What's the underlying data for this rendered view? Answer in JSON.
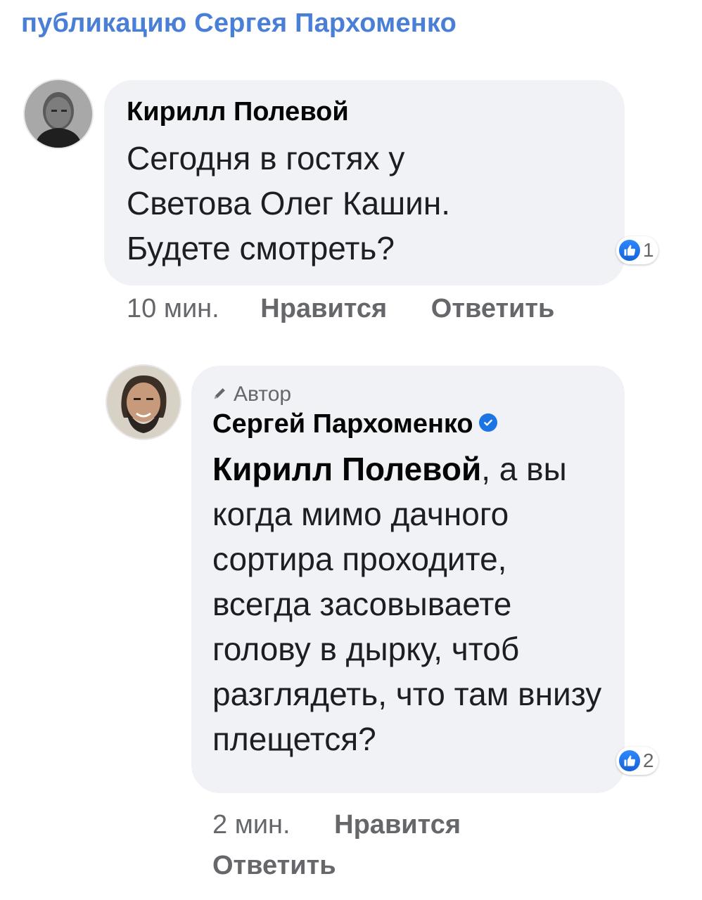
{
  "header": {
    "link_text": "публикацию Сергея Пархоменко"
  },
  "comment1": {
    "author": "Кирилл Полевой",
    "text": "Сегодня в гостях у Светова Олег Кашин. Будете смотреть?",
    "reaction_count": "1",
    "time": "10 мин.",
    "like_label": "Нравится",
    "reply_label": "Ответить"
  },
  "comment2": {
    "author_tag": "Автор",
    "author": "Сергей Пархоменко",
    "mention": "Кирилл Полевой",
    "text": ", а вы когда мимо дачного сортира проходите, всегда засовываете голову в дырку, чтоб разглядеть, что там внизу плещется?",
    "reaction_count": "2",
    "time": "2 мин.",
    "like_label": "Нравится",
    "reply_label": "Ответить"
  },
  "colors": {
    "link_blue": "#4a7fd8",
    "bubble_bg": "#f0f2f5",
    "like_blue": "#1b74e4",
    "secondary_text": "#65676b"
  },
  "icons": [
    "thumbs-up-icon",
    "pencil-icon",
    "verified-badge-icon"
  ]
}
